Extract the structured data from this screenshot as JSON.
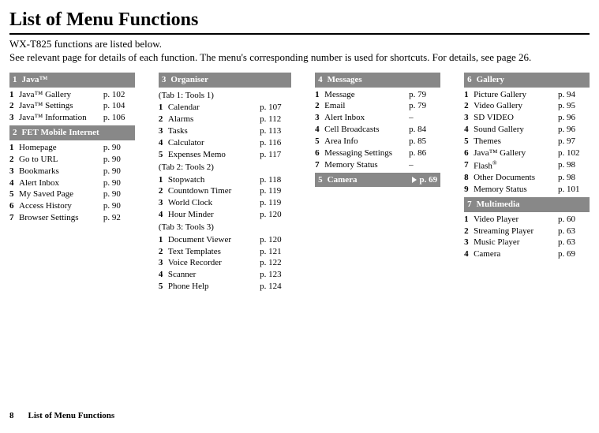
{
  "title": "List of Menu Functions",
  "intro_line1": "WX-T825 functions are listed below.",
  "intro_line2": "See relevant page for details of each function. The menu's corresponding number is used for shortcuts. For details, see page 26.",
  "footer": {
    "page_number": "8",
    "label": "List of Menu Functions"
  },
  "sections": {
    "java": {
      "num": "1",
      "title": "Java™",
      "items": [
        {
          "n": "1",
          "name": "Java™ Gallery",
          "page": "p. 102"
        },
        {
          "n": "2",
          "name": "Java™ Settings",
          "page": "p. 104"
        },
        {
          "n": "3",
          "name": "Java™ Information",
          "page": "p. 106"
        }
      ]
    },
    "fet": {
      "num": "2",
      "title": "FET Mobile Internet",
      "items": [
        {
          "n": "1",
          "name": "Homepage",
          "page": "p. 90"
        },
        {
          "n": "2",
          "name": "Go to URL",
          "page": "p. 90"
        },
        {
          "n": "3",
          "name": "Bookmarks",
          "page": "p. 90"
        },
        {
          "n": "4",
          "name": "Alert Inbox",
          "page": "p. 90"
        },
        {
          "n": "5",
          "name": "My Saved Page",
          "page": "p. 90"
        },
        {
          "n": "6",
          "name": "Access History",
          "page": "p. 90"
        },
        {
          "n": "7",
          "name": "Browser Settings",
          "page": "p. 92"
        }
      ]
    },
    "organiser": {
      "num": "3",
      "title": "Organiser",
      "tab1": {
        "label": "(Tab 1: Tools 1)",
        "items": [
          {
            "n": "1",
            "name": "Calendar",
            "page": "p. 107"
          },
          {
            "n": "2",
            "name": "Alarms",
            "page": "p. 112"
          },
          {
            "n": "3",
            "name": "Tasks",
            "page": "p. 113"
          },
          {
            "n": "4",
            "name": "Calculator",
            "page": "p. 116"
          },
          {
            "n": "5",
            "name": "Expenses Memo",
            "page": "p. 117"
          }
        ]
      },
      "tab2": {
        "label": "(Tab 2: Tools 2)",
        "items": [
          {
            "n": "1",
            "name": "Stopwatch",
            "page": "p. 118"
          },
          {
            "n": "2",
            "name": "Countdown Timer",
            "page": "p. 119"
          },
          {
            "n": "3",
            "name": "World Clock",
            "page": "p. 119"
          },
          {
            "n": "4",
            "name": "Hour Minder",
            "page": "p. 120"
          }
        ]
      },
      "tab3": {
        "label": "(Tab 3: Tools 3)",
        "items": [
          {
            "n": "1",
            "name": "Document Viewer",
            "page": "p. 120"
          },
          {
            "n": "2",
            "name": "Text Templates",
            "page": "p. 121"
          },
          {
            "n": "3",
            "name": "Voice Recorder",
            "page": "p. 122"
          },
          {
            "n": "4",
            "name": "Scanner",
            "page": "p. 123"
          },
          {
            "n": "5",
            "name": "Phone Help",
            "page": "p. 124"
          }
        ]
      }
    },
    "messages": {
      "num": "4",
      "title": "Messages",
      "items": [
        {
          "n": "1",
          "name": "Message",
          "page": "p. 79"
        },
        {
          "n": "2",
          "name": "Email",
          "page": "p. 79"
        },
        {
          "n": "3",
          "name": "Alert Inbox",
          "page": "–"
        },
        {
          "n": "4",
          "name": "Cell Broadcasts",
          "page": "p. 84"
        },
        {
          "n": "5",
          "name": "Area Info",
          "page": "p. 85"
        },
        {
          "n": "6",
          "name": "Messaging Settings",
          "page": "p. 86"
        },
        {
          "n": "7",
          "name": "Memory Status",
          "page": "–"
        }
      ]
    },
    "camera": {
      "num": "5",
      "title": "Camera",
      "page": "p. 69"
    },
    "gallery": {
      "num": "6",
      "title": "Gallery",
      "items": [
        {
          "n": "1",
          "name": "Picture Gallery",
          "page": "p. 94"
        },
        {
          "n": "2",
          "name": "Video Gallery",
          "page": "p. 95"
        },
        {
          "n": "3",
          "name": "SD VIDEO",
          "page": "p. 96"
        },
        {
          "n": "4",
          "name": "Sound Gallery",
          "page": "p. 96"
        },
        {
          "n": "5",
          "name": "Themes",
          "page": "p. 97"
        },
        {
          "n": "6",
          "name": "Java™ Gallery",
          "page": "p. 102"
        },
        {
          "n": "7",
          "name": "Flash",
          "page": "p. 98",
          "sup": "®"
        },
        {
          "n": "8",
          "name": "Other Documents",
          "page": "p. 98"
        },
        {
          "n": "9",
          "name": "Memory Status",
          "page": "p. 101"
        }
      ]
    },
    "multimedia": {
      "num": "7",
      "title": "Multimedia",
      "items": [
        {
          "n": "1",
          "name": "Video Player",
          "page": "p. 60"
        },
        {
          "n": "2",
          "name": "Streaming Player",
          "page": "p. 63"
        },
        {
          "n": "3",
          "name": "Music Player",
          "page": "p. 63"
        },
        {
          "n": "4",
          "name": "Camera",
          "page": "p. 69"
        }
      ]
    }
  }
}
